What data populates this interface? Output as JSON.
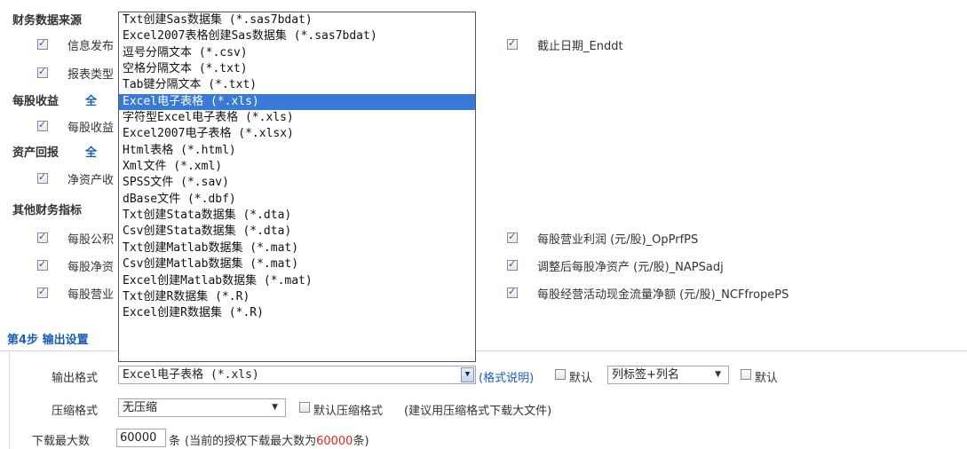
{
  "sections": {
    "financial_source": "财务数据来源",
    "eps": "每股收益",
    "eps_all": "全",
    "roa": "资产回报",
    "roa_all": "全",
    "other": "其他财务指标"
  },
  "left_checks": [
    {
      "label": "信息发布",
      "checked": true
    },
    {
      "label": "报表类型",
      "checked": true
    },
    {
      "label": "每股收益",
      "checked": true
    },
    {
      "label": "净资产收",
      "checked": true
    },
    {
      "label": "每股公积",
      "checked": true
    },
    {
      "label": "每股净资",
      "checked": true
    },
    {
      "label": "每股营业",
      "checked": true
    }
  ],
  "right_checks": [
    {
      "label": "截止日期_Enddt",
      "checked": true
    },
    {
      "label": "每股营业利润 (元/股)_OpPrfPS",
      "checked": true
    },
    {
      "label": "调整后每股净资产 (元/股)_NAPSadj",
      "checked": true
    },
    {
      "label": "每股经营活动现金流量净额 (元/股)_NCFfropePS",
      "checked": true
    }
  ],
  "dropdown_options": [
    "Txt创建Sas数据集 (*.sas7bdat)",
    "Excel2007表格创建Sas数据集 (*.sas7bdat)",
    "逗号分隔文本 (*.csv)",
    "空格分隔文本 (*.txt)",
    "Tab键分隔文本 (*.txt)",
    "Excel电子表格 (*.xls)",
    "字符型Excel电子表格 (*.xls)",
    "Excel2007电子表格 (*.xlsx)",
    "Html表格 (*.html)",
    "Xml文件 (*.xml)",
    "SPSS文件 (*.sav)",
    "dBase文件 (*.dbf)",
    "Txt创建Stata数据集 (*.dta)",
    "Csv创建Stata数据集 (*.dta)",
    "Txt创建Matlab数据集 (*.mat)",
    "Csv创建Matlab数据集 (*.mat)",
    "Excel创建Matlab数据集 (*.mat)",
    "Txt创建R数据集 (*.R)",
    "Excel创建R数据集 (*.R)"
  ],
  "selected_index": 5,
  "step4": {
    "title": "第4步 输出设置",
    "output_format_label": "输出格式",
    "output_format_value": "Excel电子表格 (*.xls)",
    "format_help": "(格式说明)",
    "default1": "默认",
    "label_mode": "列标签+列名",
    "default2": "默认",
    "compress_label": "压缩格式",
    "compress_value": "无压缩",
    "default_compress": "默认压缩格式",
    "compress_hint": "(建议用压缩格式下载大文件)",
    "max_label": "下载最大数",
    "max_value": "60000",
    "unit": "条",
    "note_prefix": "(当前的授权下载最大数为",
    "note_num": "60000",
    "note_suffix": "条)"
  }
}
